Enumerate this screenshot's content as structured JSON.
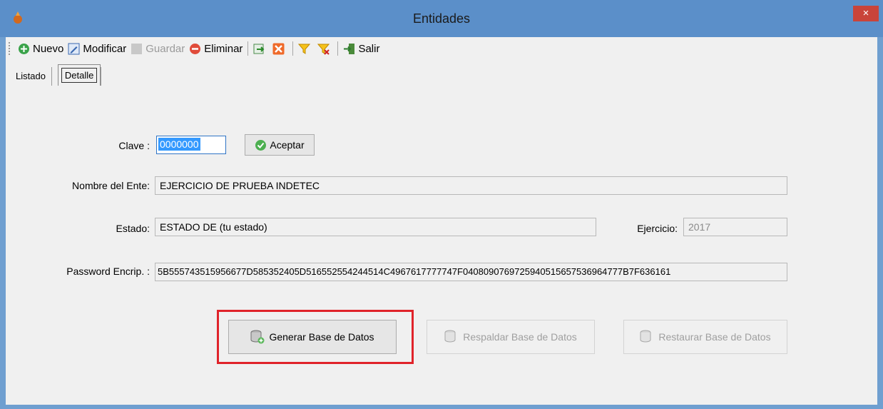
{
  "window": {
    "title": "Entidades",
    "close_label": "×"
  },
  "toolbar": {
    "nuevo": "Nuevo",
    "modificar": "Modificar",
    "guardar": "Guardar",
    "eliminar": "Eliminar",
    "salir": "Salir"
  },
  "tabs": [
    "Listado",
    "Detalle"
  ],
  "form": {
    "clave_label": "Clave :",
    "clave_value": "0000000",
    "aceptar": "Aceptar",
    "nombre_label": "Nombre del Ente:",
    "nombre_value": "EJERCICIO DE PRUEBA INDETEC",
    "estado_label": "Estado:",
    "estado_value": "ESTADO DE (tu estado)",
    "ejercicio_label": "Ejercicio:",
    "ejercicio_value": "2017",
    "password_label": "Password Encrip. :",
    "password_value": "5B555743515956677D585352405D516552554244514C4967617777747F0408090769725940515657536964777B7F636161"
  },
  "actions": {
    "generar": "Generar Base de Datos",
    "respaldar": "Respaldar Base de Datos",
    "restaurar": "Restaurar Base de Datos"
  },
  "colors": {
    "titlebar": "#5b8fc9",
    "highlight": "#e0232a",
    "selection": "#3399ff"
  },
  "icons": [
    "app-icon",
    "add-icon",
    "edit-icon",
    "save-icon",
    "delete-icon",
    "export-icon",
    "cancel-icon",
    "filter-icon",
    "clear-filter-icon",
    "exit-icon",
    "check-icon",
    "database-add-icon",
    "database-backup-icon",
    "database-restore-icon"
  ]
}
